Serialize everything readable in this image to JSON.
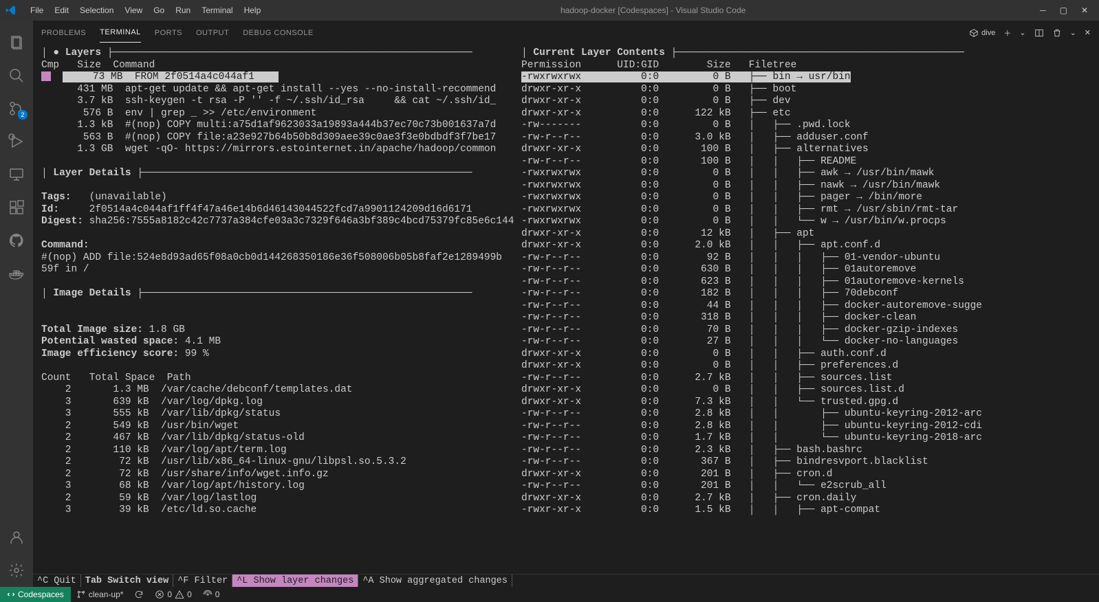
{
  "titlebar": {
    "menus": [
      "File",
      "Edit",
      "Selection",
      "View",
      "Go",
      "Run",
      "Terminal",
      "Help"
    ],
    "title": "hadoop-docker [Codespaces] - Visual Studio Code"
  },
  "activitybar": {
    "scm_badge": "2"
  },
  "panel": {
    "tabs": [
      "PROBLEMS",
      "TERMINAL",
      "PORTS",
      "OUTPUT",
      "DEBUG CONSOLE"
    ],
    "active": "TERMINAL",
    "dive_label": "dive"
  },
  "dive": {
    "headers": {
      "layers": "Layers",
      "layer_cols": "Cmp   Size  Command",
      "current_contents": "Current Layer Contents",
      "perm": "Permission",
      "uidgid": "UID:GID",
      "size": "Size",
      "filetree": "Filetree",
      "layer_details": "Layer Details",
      "image_details": "Image Details"
    },
    "layers": [
      {
        "size": "73 MB",
        "cmd": "FROM 2f0514a4c044af1",
        "selected": true,
        "marker": true
      },
      {
        "size": "431 MB",
        "cmd": "apt-get update && apt-get install --yes --no-install-recommend"
      },
      {
        "size": "3.7 kB",
        "cmd": "ssh-keygen -t rsa -P '' -f ~/.ssh/id_rsa     && cat ~/.ssh/id_"
      },
      {
        "size": "576 B",
        "cmd": "env | grep _ >> /etc/environment"
      },
      {
        "size": "1.3 kB",
        "cmd": "#(nop) COPY multi:a75d1af9623033a19893a444b37ec70c73b001637a7d"
      },
      {
        "size": "563 B",
        "cmd": "#(nop) COPY file:a23e927b64b50b8d309aee39c0ae3f3e0bdbdf3f7be17"
      },
      {
        "size": "1.3 GB",
        "cmd": "wget -qO- https://mirrors.estointernet.in/apache/hadoop/common"
      }
    ],
    "details": {
      "tags_label": "Tags:",
      "tags_value": "(unavailable)",
      "id_label": "Id:",
      "id_value": "2f0514a4c044af1ff4f47a46e14b6d46143044522fcd7a9901124209d16d6171",
      "digest_label": "Digest:",
      "digest_value": "sha256:7555a8182c42c7737a384cfe03a3c7329f646a3bf389c4bcd75379fc85e6c144",
      "command_label": "Command:",
      "command_value": "#(nop) ADD file:524e8d93ad65f08a0cb0d144268350186e36f508006b05b8faf2e1289499b59f in /"
    },
    "image": {
      "total_label": "Total Image size:",
      "total_value": "1.8 GB",
      "wasted_label": "Potential wasted space:",
      "wasted_value": "4.1 MB",
      "eff_label": "Image efficiency score:",
      "eff_value": "99 %"
    },
    "wasted_header": "Count   Total Space  Path",
    "wasted": [
      {
        "c": "2",
        "s": "1.3 MB",
        "p": "/var/cache/debconf/templates.dat"
      },
      {
        "c": "3",
        "s": "639 kB",
        "p": "/var/log/dpkg.log"
      },
      {
        "c": "3",
        "s": "555 kB",
        "p": "/var/lib/dpkg/status"
      },
      {
        "c": "2",
        "s": "549 kB",
        "p": "/usr/bin/wget"
      },
      {
        "c": "2",
        "s": "467 kB",
        "p": "/var/lib/dpkg/status-old"
      },
      {
        "c": "2",
        "s": "110 kB",
        "p": "/var/log/apt/term.log"
      },
      {
        "c": "2",
        "s": "72 kB",
        "p": "/usr/lib/x86_64-linux-gnu/libpsl.so.5.3.2"
      },
      {
        "c": "2",
        "s": "72 kB",
        "p": "/usr/share/info/wget.info.gz"
      },
      {
        "c": "3",
        "s": "68 kB",
        "p": "/var/log/apt/history.log"
      },
      {
        "c": "2",
        "s": "59 kB",
        "p": "/var/log/lastlog"
      },
      {
        "c": "3",
        "s": "39 kB",
        "p": "/etc/ld.so.cache"
      }
    ],
    "files": [
      {
        "perm": "-rwxrwxrwx",
        "ug": "0:0",
        "sz": "0 B",
        "tree": "├── bin → usr/bin",
        "selected": true
      },
      {
        "perm": "drwxr-xr-x",
        "ug": "0:0",
        "sz": "0 B",
        "tree": "├── boot"
      },
      {
        "perm": "drwxr-xr-x",
        "ug": "0:0",
        "sz": "0 B",
        "tree": "├── dev"
      },
      {
        "perm": "drwxr-xr-x",
        "ug": "0:0",
        "sz": "122 kB",
        "tree": "├── etc"
      },
      {
        "perm": "-rw-------",
        "ug": "0:0",
        "sz": "0 B",
        "tree": "│   ├── .pwd.lock"
      },
      {
        "perm": "-rw-r--r--",
        "ug": "0:0",
        "sz": "3.0 kB",
        "tree": "│   ├── adduser.conf"
      },
      {
        "perm": "drwxr-xr-x",
        "ug": "0:0",
        "sz": "100 B",
        "tree": "│   ├── alternatives"
      },
      {
        "perm": "-rw-r--r--",
        "ug": "0:0",
        "sz": "100 B",
        "tree": "│   │   ├── README"
      },
      {
        "perm": "-rwxrwxrwx",
        "ug": "0:0",
        "sz": "0 B",
        "tree": "│   │   ├── awk → /usr/bin/mawk"
      },
      {
        "perm": "-rwxrwxrwx",
        "ug": "0:0",
        "sz": "0 B",
        "tree": "│   │   ├── nawk → /usr/bin/mawk"
      },
      {
        "perm": "-rwxrwxrwx",
        "ug": "0:0",
        "sz": "0 B",
        "tree": "│   │   ├── pager → /bin/more"
      },
      {
        "perm": "-rwxrwxrwx",
        "ug": "0:0",
        "sz": "0 B",
        "tree": "│   │   ├── rmt → /usr/sbin/rmt-tar"
      },
      {
        "perm": "-rwxrwxrwx",
        "ug": "0:0",
        "sz": "0 B",
        "tree": "│   │   └── w → /usr/bin/w.procps"
      },
      {
        "perm": "drwxr-xr-x",
        "ug": "0:0",
        "sz": "12 kB",
        "tree": "│   ├── apt"
      },
      {
        "perm": "drwxr-xr-x",
        "ug": "0:0",
        "sz": "2.0 kB",
        "tree": "│   │   ├── apt.conf.d"
      },
      {
        "perm": "-rw-r--r--",
        "ug": "0:0",
        "sz": "92 B",
        "tree": "│   │   │   ├── 01-vendor-ubuntu"
      },
      {
        "perm": "-rw-r--r--",
        "ug": "0:0",
        "sz": "630 B",
        "tree": "│   │   │   ├── 01autoremove"
      },
      {
        "perm": "-rw-r--r--",
        "ug": "0:0",
        "sz": "623 B",
        "tree": "│   │   │   ├── 01autoremove-kernels"
      },
      {
        "perm": "-rw-r--r--",
        "ug": "0:0",
        "sz": "182 B",
        "tree": "│   │   │   ├── 70debconf"
      },
      {
        "perm": "-rw-r--r--",
        "ug": "0:0",
        "sz": "44 B",
        "tree": "│   │   │   ├── docker-autoremove-sugge"
      },
      {
        "perm": "-rw-r--r--",
        "ug": "0:0",
        "sz": "318 B",
        "tree": "│   │   │   ├── docker-clean"
      },
      {
        "perm": "-rw-r--r--",
        "ug": "0:0",
        "sz": "70 B",
        "tree": "│   │   │   ├── docker-gzip-indexes"
      },
      {
        "perm": "-rw-r--r--",
        "ug": "0:0",
        "sz": "27 B",
        "tree": "│   │   │   └── docker-no-languages"
      },
      {
        "perm": "drwxr-xr-x",
        "ug": "0:0",
        "sz": "0 B",
        "tree": "│   │   ├── auth.conf.d"
      },
      {
        "perm": "drwxr-xr-x",
        "ug": "0:0",
        "sz": "0 B",
        "tree": "│   │   ├── preferences.d"
      },
      {
        "perm": "-rw-r--r--",
        "ug": "0:0",
        "sz": "2.7 kB",
        "tree": "│   │   ├── sources.list"
      },
      {
        "perm": "drwxr-xr-x",
        "ug": "0:0",
        "sz": "0 B",
        "tree": "│   │   ├── sources.list.d"
      },
      {
        "perm": "drwxr-xr-x",
        "ug": "0:0",
        "sz": "7.3 kB",
        "tree": "│   │   └── trusted.gpg.d"
      },
      {
        "perm": "-rw-r--r--",
        "ug": "0:0",
        "sz": "2.8 kB",
        "tree": "│   │       ├── ubuntu-keyring-2012-arc"
      },
      {
        "perm": "-rw-r--r--",
        "ug": "0:0",
        "sz": "2.8 kB",
        "tree": "│   │       ├── ubuntu-keyring-2012-cdi"
      },
      {
        "perm": "-rw-r--r--",
        "ug": "0:0",
        "sz": "1.7 kB",
        "tree": "│   │       └── ubuntu-keyring-2018-arc"
      },
      {
        "perm": "-rw-r--r--",
        "ug": "0:0",
        "sz": "2.3 kB",
        "tree": "│   ├── bash.bashrc"
      },
      {
        "perm": "-rw-r--r--",
        "ug": "0:0",
        "sz": "367 B",
        "tree": "│   ├── bindresvport.blacklist"
      },
      {
        "perm": "drwxr-xr-x",
        "ug": "0:0",
        "sz": "201 B",
        "tree": "│   ├── cron.d"
      },
      {
        "perm": "-rw-r--r--",
        "ug": "0:0",
        "sz": "201 B",
        "tree": "│   │   └── e2scrub_all"
      },
      {
        "perm": "drwxr-xr-x",
        "ug": "0:0",
        "sz": "2.7 kB",
        "tree": "│   ├── cron.daily"
      },
      {
        "perm": "-rwxr-xr-x",
        "ug": "0:0",
        "sz": "1.5 kB",
        "tree": "│   │   ├── apt-compat"
      }
    ],
    "bottom": {
      "quit": "^C Quit",
      "switch": "Tab Switch view",
      "filter": "^F Filter",
      "changes": "^L Show layer changes",
      "aggregated": "^A Show aggregated changes"
    }
  },
  "statusbar": {
    "remote": "Codespaces",
    "branch": "clean-up*",
    "errors": "0",
    "warnings": "0",
    "ports": "0"
  }
}
